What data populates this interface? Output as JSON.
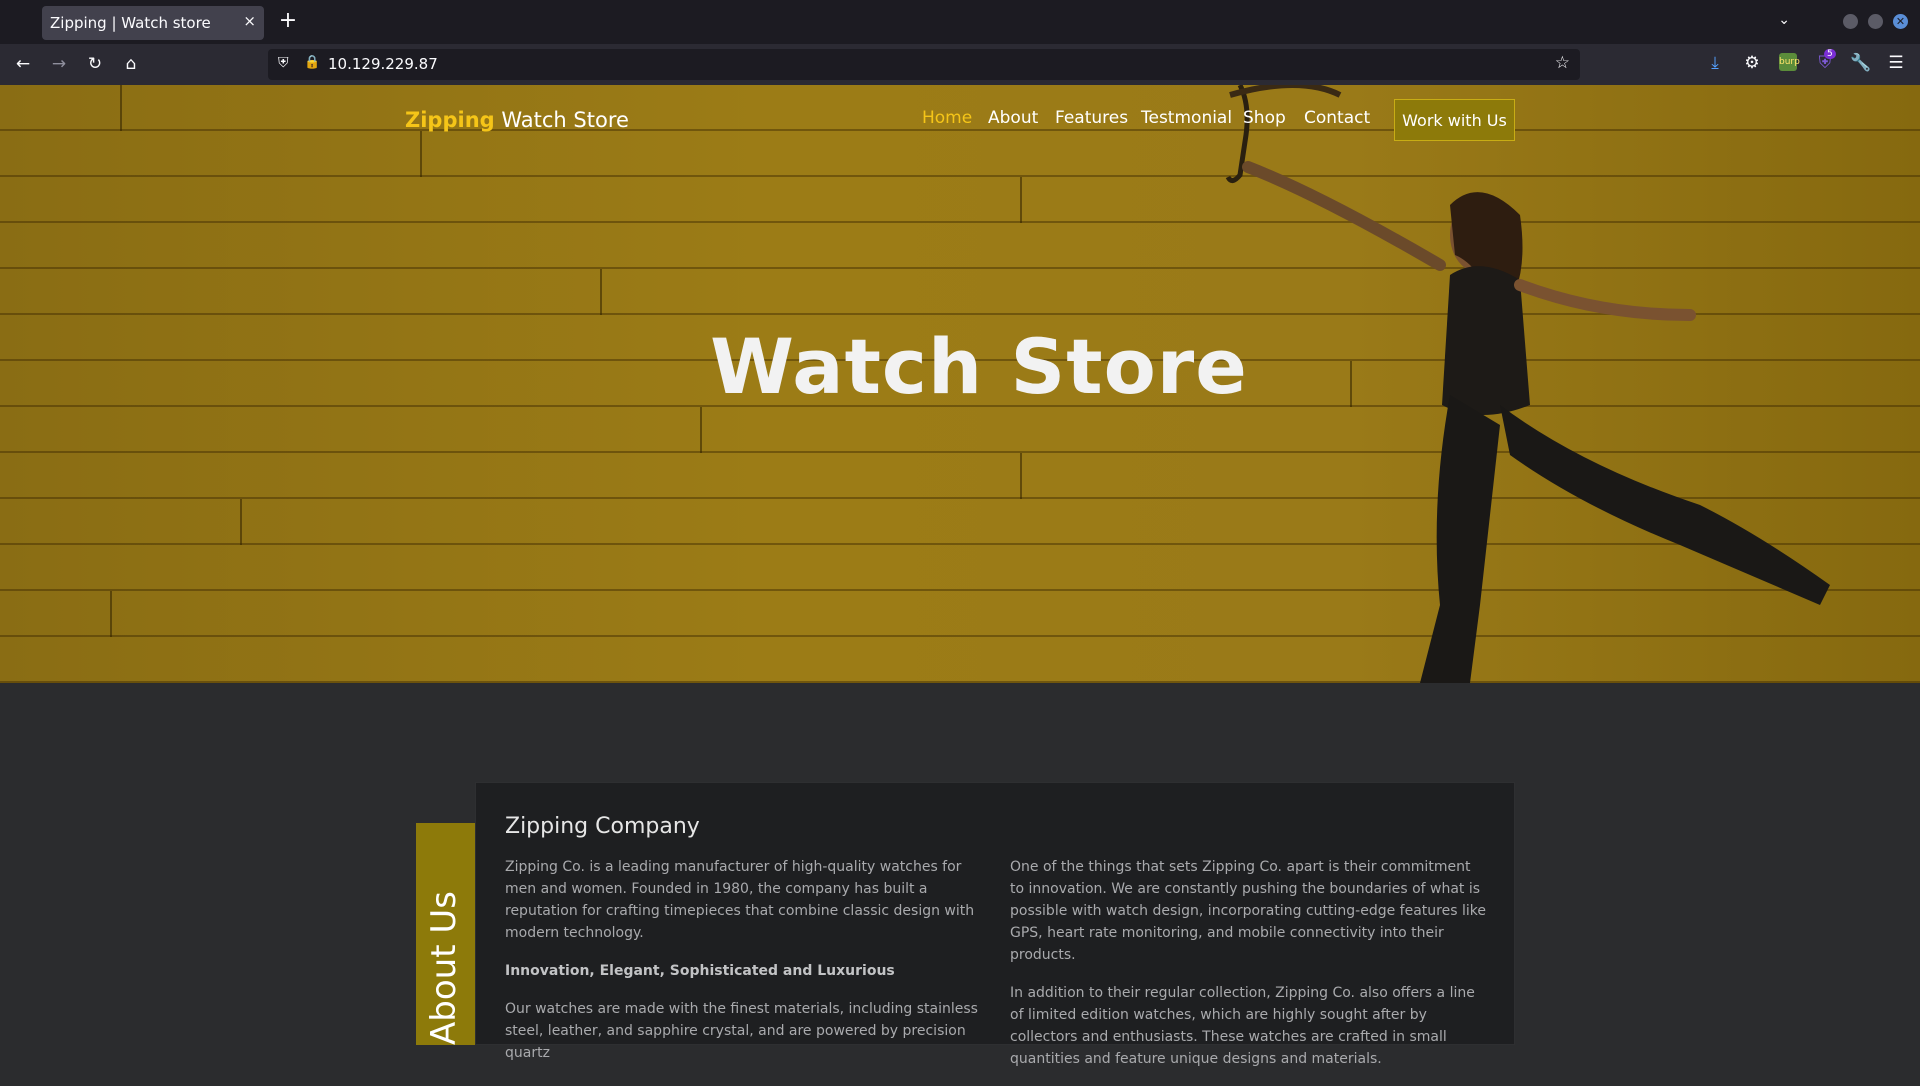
{
  "browser": {
    "tab_title": "Zipping | Watch store",
    "tab_close": "×",
    "new_tab": "+",
    "url": "10.129.229.87",
    "ext_badge": "5",
    "burp_label": "burp"
  },
  "site": {
    "brand_highlight": "Zipping",
    "brand_rest": " Watch Store",
    "nav": {
      "home": "Home",
      "about": "About",
      "features": "Features",
      "testimonial": "Testmonial",
      "shop": "Shop",
      "contact": "Contact"
    },
    "cta": "Work with Us",
    "hero_title": "Watch Store"
  },
  "about": {
    "tab_label": "About Us",
    "heading": "Zipping Company",
    "left_paragraphs": [
      "Zipping Co. is a leading manufacturer of high-quality watches for men and women. Founded in 1980, the company has built a reputation for crafting timepieces that combine classic design with modern technology.",
      "Innovation, Elegant, Sophisticated and Luxurious",
      "Our watches are made with the finest materials, including stainless steel, leather, and sapphire crystal, and are powered by precision quartz"
    ],
    "right_paragraphs": [
      "One of the things that sets Zipping Co. apart is their commitment to innovation. We are constantly pushing the boundaries of what is possible with watch design, incorporating cutting-edge features like GPS, heart rate monitoring, and mobile connectivity into their products.",
      "In addition to their regular collection, Zipping Co. also offers a line of limited edition watches, which are highly sought after by collectors and enthusiasts. These watches are crafted in small quantities and feature unique designs and materials."
    ]
  },
  "colors": {
    "accent": "#f5c518",
    "cta_bg": "#8d7a0a",
    "hero_bg": "#9a7a18",
    "card_bg": "#1e1f21"
  }
}
